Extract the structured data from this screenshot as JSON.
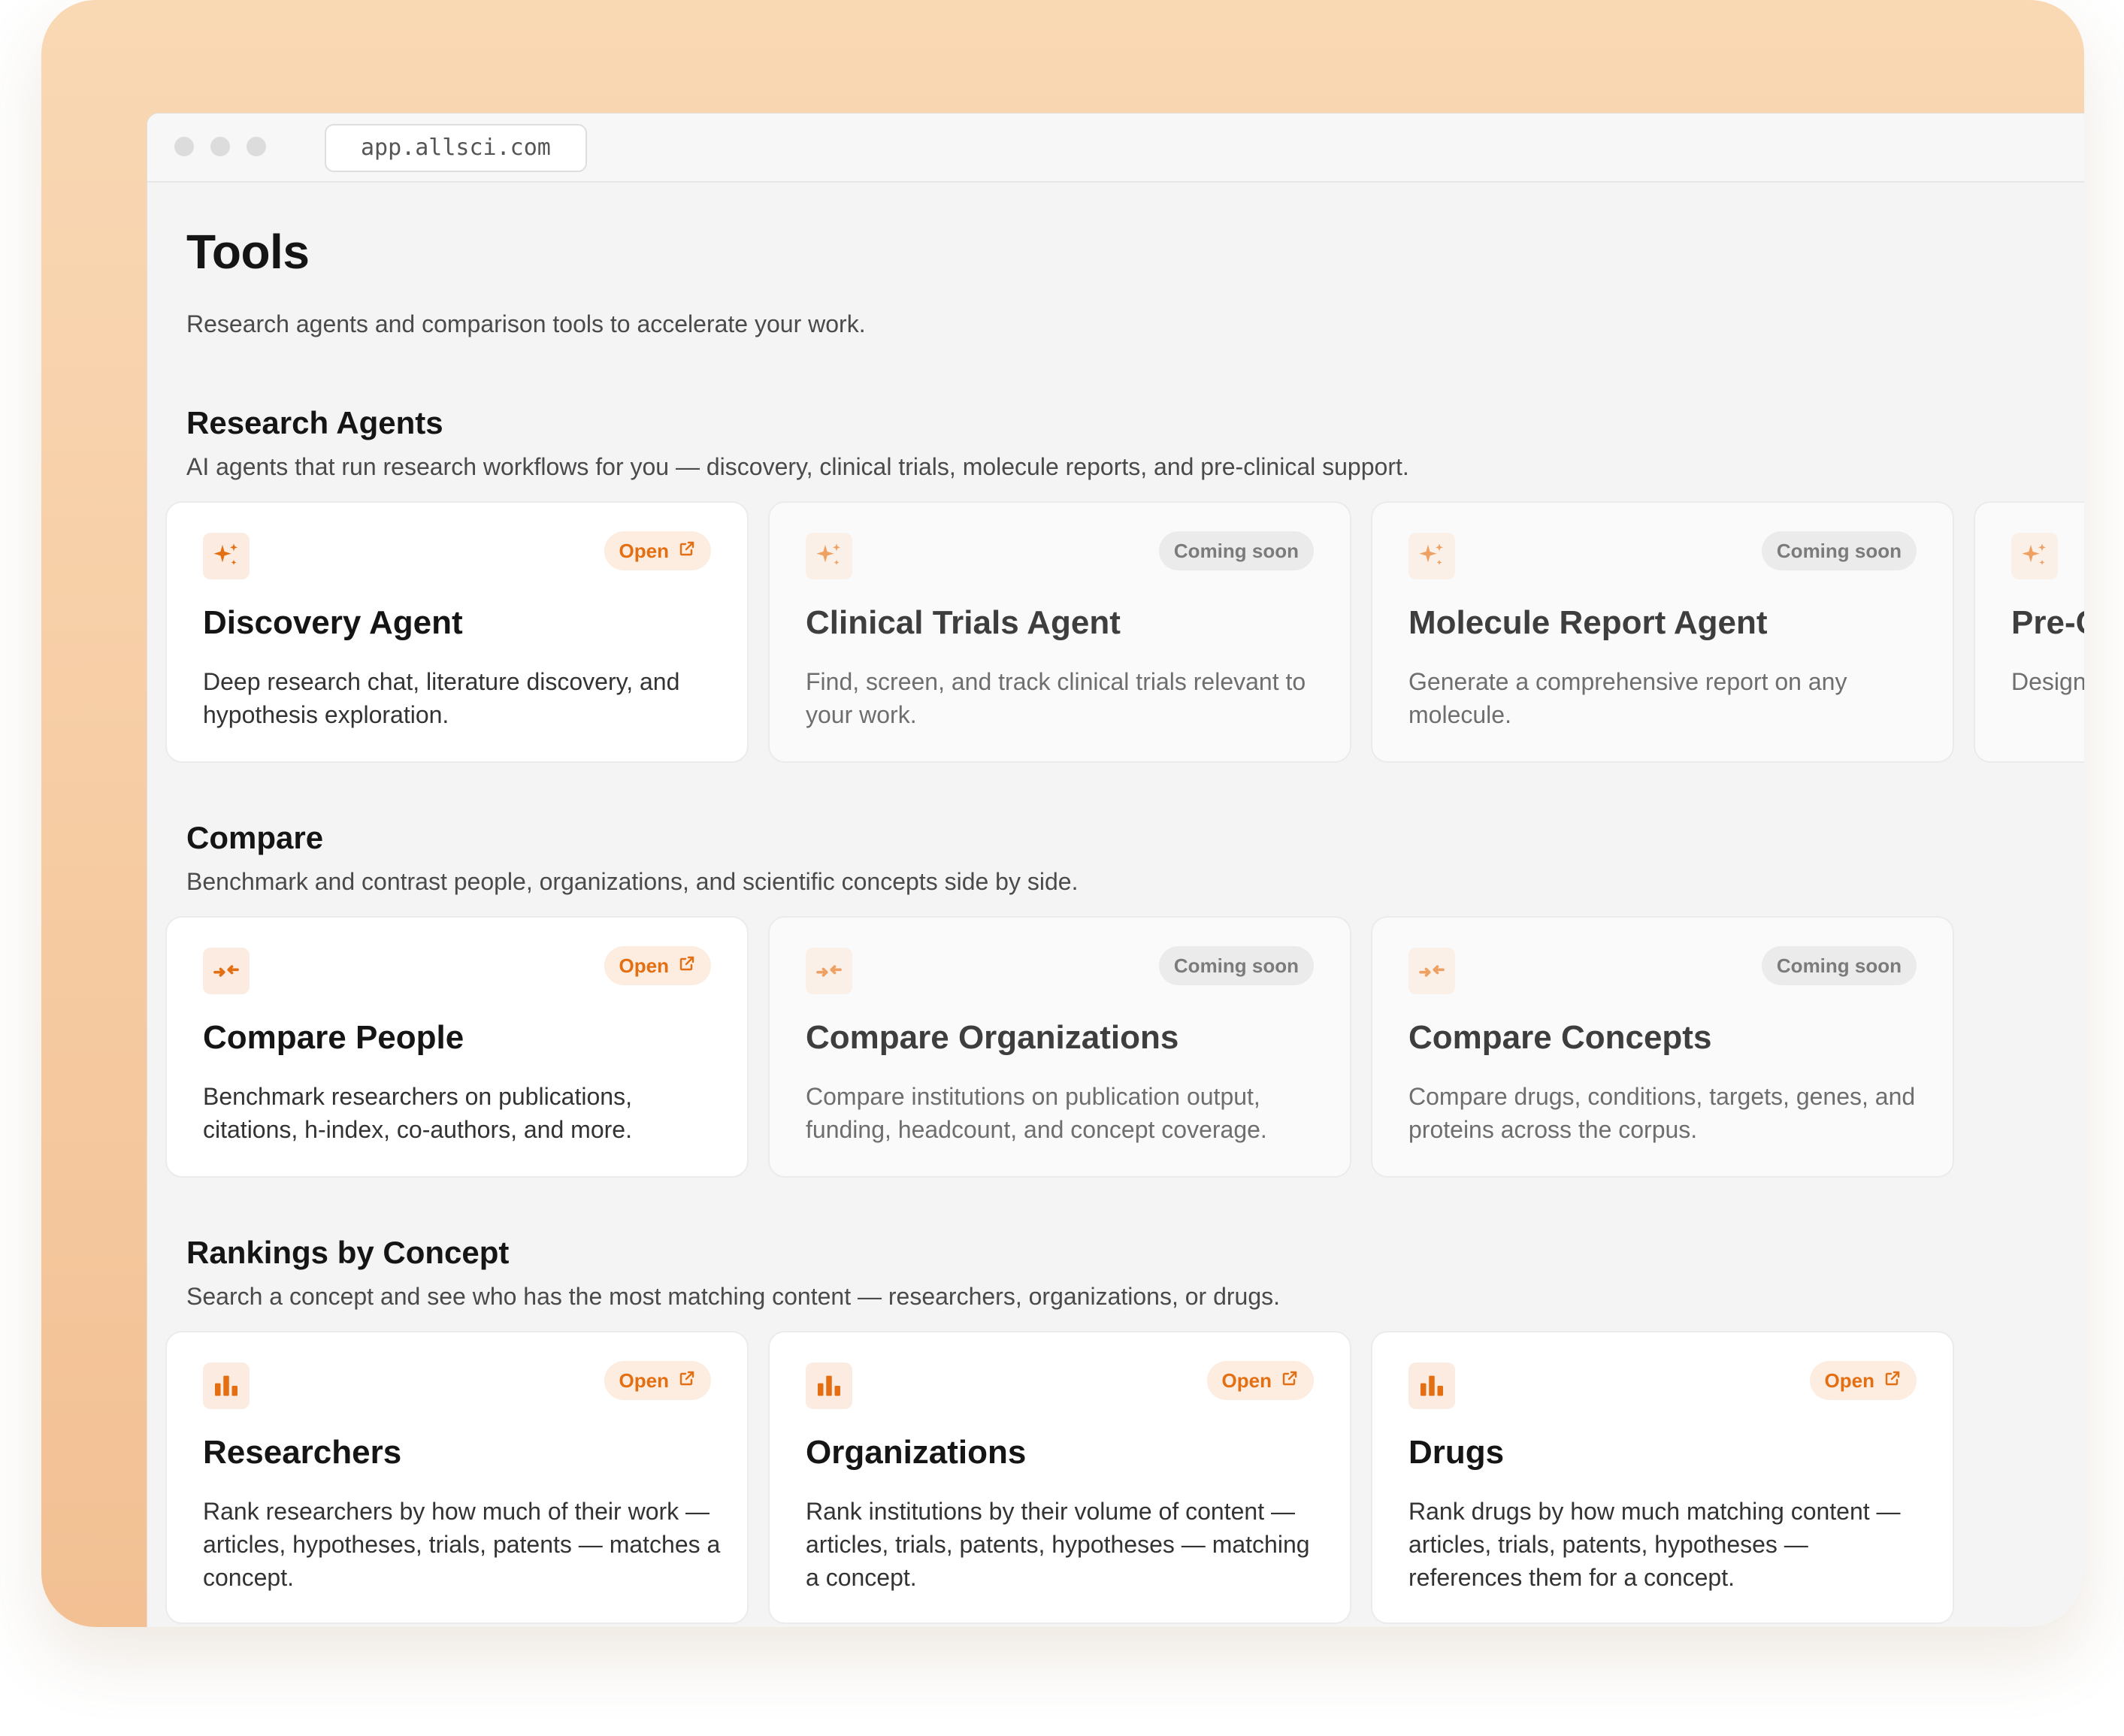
{
  "browser": {
    "url": "app.allsci.com"
  },
  "page": {
    "title": "Tools",
    "subtitle": "Research agents and comparison tools to accelerate your work."
  },
  "badges": {
    "open": "Open",
    "coming_soon": "Coming soon"
  },
  "icons": {
    "research": "sparkles-icon",
    "compare": "compare-arrows-icon",
    "rankings": "bar-chart-icon",
    "open": "external-link-icon"
  },
  "colors": {
    "accent": "#e46f12",
    "accent_bg": "#fdece0",
    "frame": "#f6cba2"
  },
  "sections": [
    {
      "title": "Research Agents",
      "description": "AI agents that run research workflows for you — discovery, clinical trials, molecule reports, and pre-clinical support.",
      "cards": [
        {
          "title": "Discovery Agent",
          "description": "Deep research chat, literature discovery, and hypothesis exploration.",
          "status": "Open"
        },
        {
          "title": "Clinical Trials Agent",
          "description": "Find, screen, and track clinical trials relevant to your work.",
          "status": "Coming soon"
        },
        {
          "title": "Molecule Report Agent",
          "description": "Generate a comprehensive report on any molecule.",
          "status": "Coming soon"
        },
        {
          "title": "Pre-C",
          "description": "Design a and stu",
          "status": ""
        }
      ]
    },
    {
      "title": "Compare",
      "description": "Benchmark and contrast people, organizations, and scientific concepts side by side.",
      "cards": [
        {
          "title": "Compare People",
          "description": "Benchmark researchers on publications, citations, h-index, co-authors, and more.",
          "status": "Open"
        },
        {
          "title": "Compare Organizations",
          "description": "Compare institutions on publication output, funding, headcount, and concept coverage.",
          "status": "Coming soon"
        },
        {
          "title": "Compare Concepts",
          "description": "Compare drugs, conditions, targets, genes, and proteins across the corpus.",
          "status": "Coming soon"
        }
      ]
    },
    {
      "title": "Rankings by Concept",
      "description": "Search a concept and see who has the most matching content — researchers, organizations, or drugs.",
      "cards": [
        {
          "title": "Researchers",
          "description": "Rank researchers by how much of their work — articles, hypotheses, trials, patents — matches a concept.",
          "status": "Open"
        },
        {
          "title": "Organizations",
          "description": "Rank institutions by their volume of content — articles, trials, patents, hypotheses — matching a concept.",
          "status": "Open"
        },
        {
          "title": "Drugs",
          "description": "Rank drugs by how much matching content — articles, trials, patents, hypotheses — references them for a concept.",
          "status": "Open"
        }
      ]
    }
  ]
}
